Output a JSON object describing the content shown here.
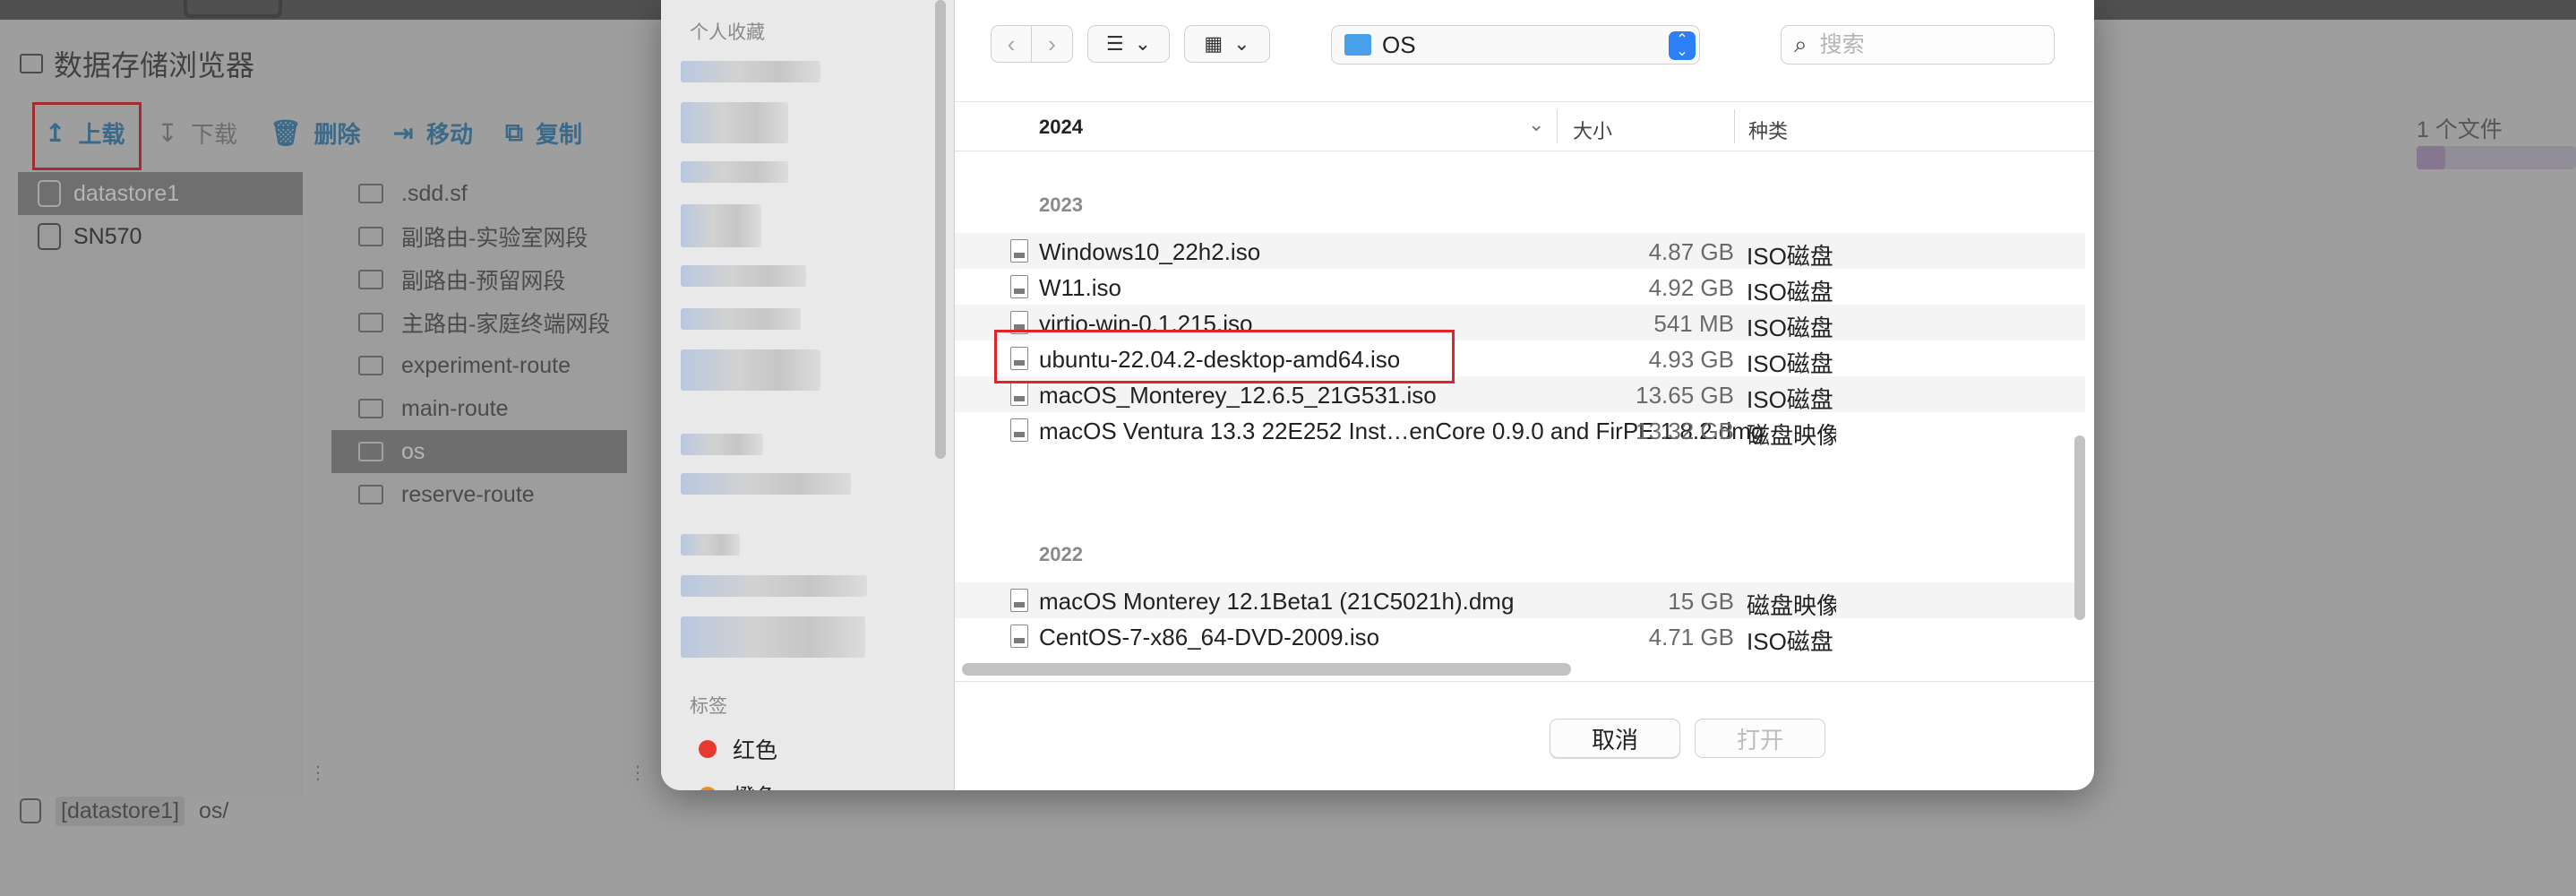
{
  "bg": {
    "title": "数据存储浏览器",
    "toolbar": [
      {
        "label": "上载",
        "glyph": "↥",
        "enabled": true
      },
      {
        "label": "下载",
        "glyph": "↧",
        "enabled": false
      },
      {
        "label": "删除",
        "glyph": "🗑",
        "enabled": true
      },
      {
        "label": "移动",
        "glyph": "⇥",
        "enabled": true
      },
      {
        "label": "复制",
        "glyph": "⧉",
        "enabled": true
      }
    ],
    "file_count": "1 个文件",
    "progress": 0.18,
    "datastores": [
      {
        "label": "datastore1",
        "selected": true
      },
      {
        "label": "SN570",
        "selected": false
      }
    ],
    "folders": [
      {
        "label": ".sdd.sf",
        "selected": false
      },
      {
        "label": "副路由-实验室网段",
        "selected": false
      },
      {
        "label": "副路由-预留网段",
        "selected": false
      },
      {
        "label": "主路由-家庭终端网段",
        "selected": false
      },
      {
        "label": "experiment-route",
        "selected": false
      },
      {
        "label": "main-route",
        "selected": false
      },
      {
        "label": "os",
        "selected": true
      },
      {
        "label": "reserve-route",
        "selected": false
      }
    ],
    "status_ds": "[datastore1]",
    "status_path": "os/"
  },
  "dialog": {
    "sidebar": {
      "favorites_header": "个人收藏",
      "tags_header": "标签",
      "tags": [
        {
          "label": "红色",
          "color": "#e8392f"
        },
        {
          "label": "橙色",
          "color": "#f08a24"
        }
      ]
    },
    "location": "OS",
    "search_placeholder": "搜索",
    "columns": {
      "name": "2024",
      "size": "大小",
      "kind": "种类"
    },
    "groups": [
      {
        "label": "2023",
        "files": [
          {
            "name": "Windows10_22h2.iso",
            "size": "4.87 GB",
            "kind": "ISO磁盘"
          },
          {
            "name": "W11.iso",
            "size": "4.92 GB",
            "kind": "ISO磁盘"
          },
          {
            "name": "virtio-win-0.1.215.iso",
            "size": "541 MB",
            "kind": "ISO磁盘"
          },
          {
            "name": "ubuntu-22.04.2-desktop-amd64.iso",
            "size": "4.93 GB",
            "kind": "ISO磁盘"
          },
          {
            "name": "macOS_Monterey_12.6.5_21G531.iso",
            "size": "13.65 GB",
            "kind": "ISO磁盘"
          },
          {
            "name": "macOS Ventura 13.3 22E252 Inst…enCore 0.9.0 and FirPE 1.8.2.dmg",
            "size": "13.32 GB",
            "kind": "磁盘映像"
          }
        ]
      },
      {
        "label": "2022",
        "files": [
          {
            "name": "macOS Monterey 12.1Beta1 (21C5021h).dmg",
            "size": "15 GB",
            "kind": "磁盘映像"
          },
          {
            "name": "CentOS-7-x86_64-DVD-2009.iso",
            "size": "4.71 GB",
            "kind": "ISO磁盘"
          }
        ]
      }
    ],
    "cancel": "取消",
    "open": "打开"
  }
}
